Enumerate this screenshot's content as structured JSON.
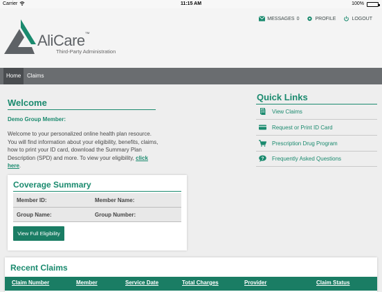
{
  "status_bar": {
    "carrier": "Carrier",
    "time": "11:15 AM",
    "battery": "100%",
    "battery_level": 1.0
  },
  "brand": {
    "name": "AliCare",
    "trademark": "™",
    "tagline": "Third-Party Administration",
    "color": "#1a8a6e",
    "logo_gray": "#5e6266"
  },
  "topnav": [
    {
      "label": "MESSAGES",
      "count": "0",
      "icon": "envelope-icon"
    },
    {
      "label": "PROFILE",
      "icon": "gear-icon"
    },
    {
      "label": "LOGOUT",
      "icon": "power-icon"
    }
  ],
  "navbar": {
    "home": "Home",
    "claims": "Claims"
  },
  "welcome": {
    "title": "Welcome",
    "member": "Demo Group Member:",
    "intro": "Welcome to your personalized online health plan resource. You will find information about your eligibility, benefits, claims, how to print your ID card, download the Summary Plan Description (SPD) and more. To view your eligibility,",
    "link": "click here",
    "period": "."
  },
  "coverage": {
    "title": "Coverage Summary",
    "rows": [
      {
        "l1": "Member ID:",
        "l2": "Member Name:"
      },
      {
        "l1": "Group Name:",
        "l2": "Group Number:"
      }
    ],
    "button": "View Full Eligibility"
  },
  "quick_links": {
    "title": "Quick Links",
    "items": [
      {
        "label": "View Claims",
        "icon": "document-icon"
      },
      {
        "label": "Request or Print ID Card",
        "icon": "id-card-icon"
      },
      {
        "label": "Prescription Drug Program",
        "icon": "cart-icon"
      },
      {
        "label": "Frequently Asked Questions",
        "icon": "question-icon"
      }
    ]
  },
  "recent_claims": {
    "title": "Recent Claims",
    "columns": [
      "Claim Number",
      "Member",
      "Service Date",
      "Total Charges",
      "Provider",
      "Claim Status"
    ]
  }
}
